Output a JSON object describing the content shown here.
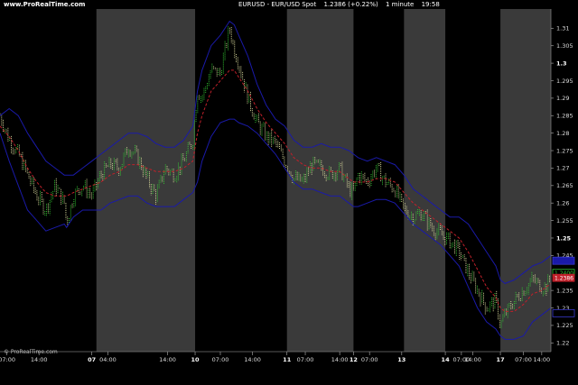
{
  "header": {
    "site": "www.ProRealTime.com",
    "instrument": "EURUSD - EUR/USD Spot",
    "last": "1.2386 (+0.22%)",
    "timeframe": "1 minute",
    "time": "19:58"
  },
  "footer": {
    "copyright": "© ProRealTime.com"
  },
  "colors": {
    "background": "#000000",
    "session_band": "#3a3a3a",
    "bollinger": "#1a1aa8",
    "moving_average": "#c0202a",
    "up": "#33cc33",
    "down": "#e0e0a0"
  },
  "chart_data": {
    "type": "line",
    "ylim": [
      1.2175,
      1.3155
    ],
    "y_ticks": [
      {
        "label": "1.31",
        "v": 1.31,
        "bold": false
      },
      {
        "label": "1.305",
        "v": 1.305,
        "bold": false
      },
      {
        "label": "1.3",
        "v": 1.3,
        "bold": true
      },
      {
        "label": "1.295",
        "v": 1.295,
        "bold": false
      },
      {
        "label": "1.29",
        "v": 1.29,
        "bold": false
      },
      {
        "label": "1.285",
        "v": 1.285,
        "bold": false
      },
      {
        "label": "1.28",
        "v": 1.28,
        "bold": false
      },
      {
        "label": "1.275",
        "v": 1.275,
        "bold": false
      },
      {
        "label": "1.27",
        "v": 1.27,
        "bold": false
      },
      {
        "label": "1.265",
        "v": 1.265,
        "bold": false
      },
      {
        "label": "1.26",
        "v": 1.26,
        "bold": false
      },
      {
        "label": "1.255",
        "v": 1.255,
        "bold": false
      },
      {
        "label": "1.25",
        "v": 1.25,
        "bold": true
      },
      {
        "label": "1.245",
        "v": 1.245,
        "bold": false
      },
      {
        "label": "1.235",
        "v": 1.235,
        "bold": false
      },
      {
        "label": "1.23",
        "v": 1.23,
        "bold": false
      },
      {
        "label": "1.225",
        "v": 1.225,
        "bold": false
      },
      {
        "label": "1.22",
        "v": 1.22,
        "bold": false
      }
    ],
    "x_ticks": [
      {
        "label": "07:00",
        "t": 3,
        "bold": false
      },
      {
        "label": "14:00",
        "t": 17,
        "bold": false
      },
      {
        "label": "07",
        "t": 40,
        "bold": true
      },
      {
        "label": "04:00",
        "t": 47,
        "bold": false
      },
      {
        "label": "14:00",
        "t": 73,
        "bold": false
      },
      {
        "label": "10",
        "t": 85,
        "bold": true
      },
      {
        "label": "07:00",
        "t": 96,
        "bold": false
      },
      {
        "label": "14:00",
        "t": 110,
        "bold": false
      },
      {
        "label": "11",
        "t": 125,
        "bold": true
      },
      {
        "label": "07:00",
        "t": 133,
        "bold": false
      },
      {
        "label": "14:00",
        "t": 148,
        "bold": false
      },
      {
        "label": "12",
        "t": 154,
        "bold": true
      },
      {
        "label": "07:00",
        "t": 161,
        "bold": false
      },
      {
        "label": "13",
        "t": 175,
        "bold": true
      },
      {
        "label": "14",
        "t": 194,
        "bold": true
      },
      {
        "label": "07:00",
        "t": 201,
        "bold": false
      },
      {
        "label": "14:00",
        "t": 206,
        "bold": false
      },
      {
        "label": "17",
        "t": 218,
        "bold": true
      },
      {
        "label": "07:00",
        "t": 228,
        "bold": false
      },
      {
        "label": "14:00",
        "t": 236,
        "bold": false
      }
    ],
    "session_bands": [
      [
        42,
        85
      ],
      [
        125,
        154
      ],
      [
        176,
        194
      ],
      [
        218,
        240
      ]
    ],
    "price_x": [
      0,
      4,
      8,
      12,
      16,
      20,
      24,
      28,
      29,
      32,
      36,
      40,
      44,
      48,
      52,
      56,
      60,
      64,
      68,
      72,
      76,
      80,
      84,
      86,
      88,
      92,
      96,
      100,
      102,
      104,
      108,
      112,
      116,
      120,
      124,
      128,
      132,
      136,
      140,
      144,
      148,
      152,
      154,
      156,
      160,
      164,
      168,
      172,
      176,
      180,
      184,
      188,
      192,
      196,
      200,
      204,
      208,
      212,
      216,
      218,
      220,
      224,
      228,
      232,
      236,
      238,
      240
    ],
    "price": [
      1.285,
      1.278,
      1.274,
      1.268,
      1.262,
      1.258,
      1.265,
      1.26,
      1.254,
      1.262,
      1.265,
      1.262,
      1.268,
      1.271,
      1.27,
      1.276,
      1.273,
      1.267,
      1.262,
      1.27,
      1.268,
      1.272,
      1.278,
      1.292,
      1.29,
      1.298,
      1.297,
      1.31,
      1.304,
      1.3,
      1.29,
      1.283,
      1.279,
      1.277,
      1.272,
      1.267,
      1.266,
      1.271,
      1.27,
      1.268,
      1.27,
      1.264,
      1.263,
      1.268,
      1.266,
      1.27,
      1.266,
      1.264,
      1.258,
      1.256,
      1.257,
      1.253,
      1.251,
      1.249,
      1.246,
      1.24,
      1.235,
      1.23,
      1.232,
      1.225,
      1.228,
      1.232,
      1.235,
      1.238,
      1.236,
      1.236,
      1.239
    ],
    "ma": [
      1.282,
      1.279,
      1.275,
      1.27,
      1.266,
      1.263,
      1.262,
      1.262,
      1.262,
      1.263,
      1.264,
      1.265,
      1.266,
      1.268,
      1.269,
      1.271,
      1.271,
      1.27,
      1.269,
      1.269,
      1.269,
      1.27,
      1.272,
      1.28,
      1.285,
      1.292,
      1.295,
      1.298,
      1.298,
      1.296,
      1.292,
      1.287,
      1.283,
      1.28,
      1.277,
      1.273,
      1.271,
      1.27,
      1.27,
      1.269,
      1.269,
      1.267,
      1.266,
      1.266,
      1.266,
      1.267,
      1.267,
      1.266,
      1.263,
      1.26,
      1.258,
      1.256,
      1.254,
      1.252,
      1.25,
      1.246,
      1.241,
      1.236,
      1.233,
      1.23,
      1.229,
      1.229,
      1.231,
      1.234,
      1.235,
      1.236,
      1.237
    ],
    "bb_upper": [
      1.285,
      1.287,
      1.285,
      1.28,
      1.276,
      1.272,
      1.27,
      1.268,
      1.268,
      1.268,
      1.27,
      1.272,
      1.274,
      1.276,
      1.278,
      1.28,
      1.28,
      1.279,
      1.277,
      1.276,
      1.276,
      1.278,
      1.282,
      1.292,
      1.298,
      1.305,
      1.308,
      1.312,
      1.311,
      1.308,
      1.302,
      1.294,
      1.288,
      1.284,
      1.282,
      1.278,
      1.276,
      1.276,
      1.277,
      1.276,
      1.276,
      1.275,
      1.274,
      1.273,
      1.272,
      1.273,
      1.272,
      1.271,
      1.268,
      1.264,
      1.262,
      1.26,
      1.258,
      1.256,
      1.256,
      1.254,
      1.25,
      1.246,
      1.242,
      1.238,
      1.237,
      1.238,
      1.24,
      1.242,
      1.243,
      1.244,
      1.245
    ],
    "bb_lower": [
      1.28,
      1.272,
      1.265,
      1.258,
      1.255,
      1.252,
      1.253,
      1.254,
      1.253,
      1.256,
      1.258,
      1.258,
      1.258,
      1.26,
      1.261,
      1.262,
      1.262,
      1.26,
      1.259,
      1.259,
      1.259,
      1.261,
      1.263,
      1.266,
      1.272,
      1.279,
      1.283,
      1.284,
      1.284,
      1.283,
      1.282,
      1.28,
      1.277,
      1.274,
      1.27,
      1.266,
      1.264,
      1.264,
      1.263,
      1.262,
      1.262,
      1.26,
      1.259,
      1.259,
      1.26,
      1.261,
      1.261,
      1.26,
      1.257,
      1.254,
      1.252,
      1.25,
      1.248,
      1.245,
      1.242,
      1.236,
      1.23,
      1.226,
      1.224,
      1.222,
      1.221,
      1.221,
      1.222,
      1.226,
      1.228,
      1.229,
      1.23
    ],
    "price_tags": [
      {
        "label": "1.2400",
        "v": 1.24,
        "color": "#33cc33",
        "fill": "#000000"
      },
      {
        "label": "1.2386",
        "v": 1.2386,
        "color": "#c0202a",
        "fill": "#c0202a"
      },
      {
        "label": "",
        "v": 1.2435,
        "color": "#3a3ad0",
        "fill": "#1a1aa8"
      },
      {
        "label": "",
        "v": 1.2285,
        "color": "#3a3ad0",
        "fill": "#000000"
      }
    ]
  }
}
